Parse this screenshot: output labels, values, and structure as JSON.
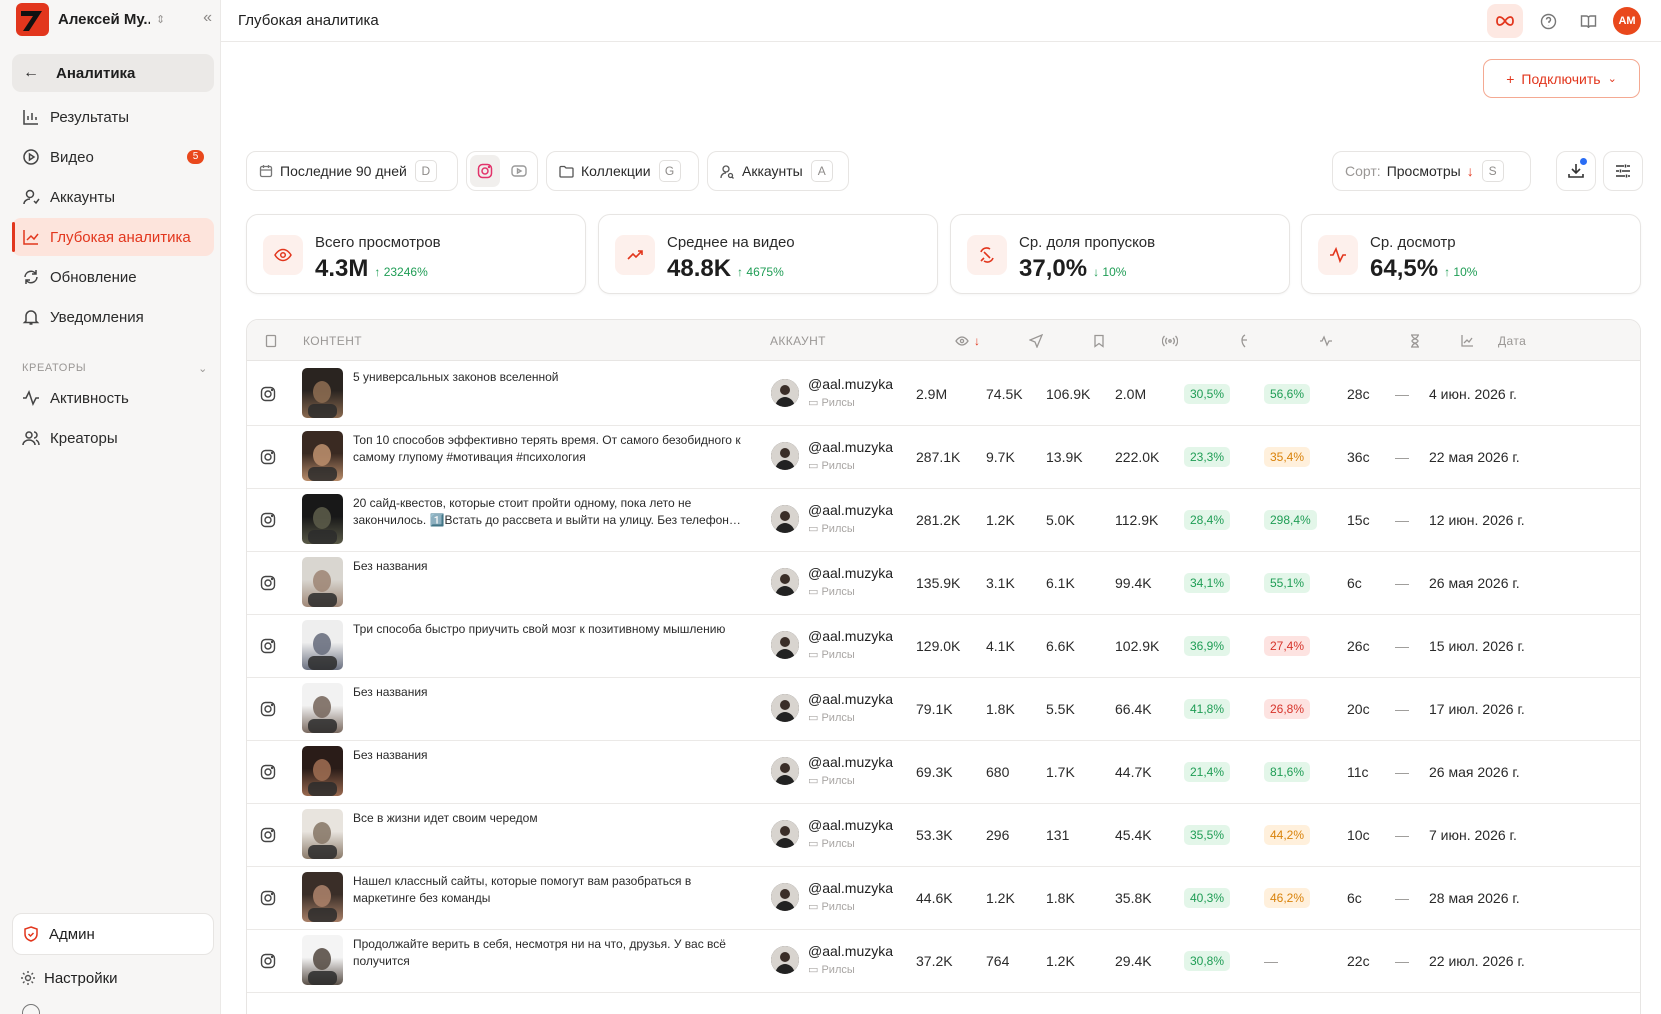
{
  "workspace": {
    "name": "Алексей Му..."
  },
  "sidebar": {
    "back_label": "Аналитика",
    "items": [
      {
        "label": "Результаты",
        "icon": "bar-chart-icon"
      },
      {
        "label": "Видео",
        "icon": "play-circle-icon",
        "badge": "5"
      },
      {
        "label": "Аккаунты",
        "icon": "user-icon"
      },
      {
        "label": "Глубокая аналитика",
        "icon": "line-chart-icon",
        "active": true
      },
      {
        "label": "Обновление",
        "icon": "refresh-icon"
      },
      {
        "label": "Уведомления",
        "icon": "bell-icon"
      }
    ],
    "section_label": "КРЕАТОРЫ",
    "section_items": [
      {
        "label": "Активность",
        "icon": "activity-icon"
      },
      {
        "label": "Креаторы",
        "icon": "users-icon"
      }
    ],
    "admin_label": "Админ",
    "settings_label": "Настройки"
  },
  "header": {
    "title": "Глубокая аналитика",
    "avatar_initials": "AM"
  },
  "connect_label": "Подключить",
  "filters": {
    "period": {
      "label": "Последние 90 дней",
      "key": "D"
    },
    "collections": {
      "label": "Коллекции",
      "key": "G"
    },
    "accounts": {
      "label": "Аккаунты",
      "key": "A"
    },
    "sort": {
      "prefix": "Сорт:",
      "value": "Просмотры",
      "key": "S"
    }
  },
  "stats": [
    {
      "label": "Всего просмотров",
      "value": "4.3M",
      "delta": "23246%",
      "icon": "eye-icon"
    },
    {
      "label": "Среднее на видео",
      "value": "48.8K",
      "delta": "4675%",
      "icon": "trending-up-icon"
    },
    {
      "label": "Ср. доля пропусков",
      "value": "37,0%",
      "delta": "10%",
      "delta_dir": "down",
      "icon": "skip-icon"
    },
    {
      "label": "Ср. досмотр",
      "value": "64,5%",
      "delta": "10%",
      "icon": "pulse-icon"
    }
  ],
  "table": {
    "headers": {
      "content": "КОНТЕНТ",
      "account": "АККАУНТ",
      "date": "Дата"
    },
    "rows": [
      {
        "title": "5 универсальных законов вселенной",
        "account": "@aal.muzyka",
        "type": "Рилсы",
        "views": "2.9M",
        "shares": "74.5K",
        "saves": "106.9K",
        "reach": "2.0M",
        "skip": "30,5%",
        "skip_c": "g",
        "watch": "56,6%",
        "watch_c": "g",
        "dur": "28с",
        "extra": "—",
        "date": "4 июн. 2026 г."
      },
      {
        "title": "Топ 10 способов эффективно терять время. От самого безобидного к самому глупому #мотивация #психология",
        "account": "@aal.muzyka",
        "type": "Рилсы",
        "views": "287.1K",
        "shares": "9.7K",
        "saves": "13.9K",
        "reach": "222.0K",
        "skip": "23,3%",
        "skip_c": "g",
        "watch": "35,4%",
        "watch_c": "o",
        "dur": "36с",
        "extra": "—",
        "date": "22 мая 2026 г."
      },
      {
        "title": "20 сайд-квестов, которые стоит пройти одному, пока лето не закончилось. 1️⃣Встать до рассвета и выйти на улицу. Без телефон…",
        "account": "@aal.muzyka",
        "type": "Рилсы",
        "views": "281.2K",
        "shares": "1.2K",
        "saves": "5.0K",
        "reach": "112.9K",
        "skip": "28,4%",
        "skip_c": "g",
        "watch": "298,4%",
        "watch_c": "g",
        "dur": "15с",
        "extra": "—",
        "date": "12 июн. 2026 г."
      },
      {
        "title": "Без названия",
        "account": "@aal.muzyka",
        "type": "Рилсы",
        "views": "135.9K",
        "shares": "3.1K",
        "saves": "6.1K",
        "reach": "99.4K",
        "skip": "34,1%",
        "skip_c": "g",
        "watch": "55,1%",
        "watch_c": "g",
        "dur": "6с",
        "extra": "—",
        "date": "26 мая 2026 г."
      },
      {
        "title": "Три способа быстро приучить свой мозг к позитивному мышлению",
        "account": "@aal.muzyka",
        "type": "Рилсы",
        "views": "129.0K",
        "shares": "4.1K",
        "saves": "6.6K",
        "reach": "102.9K",
        "skip": "36,9%",
        "skip_c": "g",
        "watch": "27,4%",
        "watch_c": "r",
        "dur": "26с",
        "extra": "—",
        "date": "15 июл. 2026 г."
      },
      {
        "title": "Без названия",
        "account": "@aal.muzyka",
        "type": "Рилсы",
        "views": "79.1K",
        "shares": "1.8K",
        "saves": "5.5K",
        "reach": "66.4K",
        "skip": "41,8%",
        "skip_c": "g",
        "watch": "26,8%",
        "watch_c": "r",
        "dur": "20с",
        "extra": "—",
        "date": "17 июл. 2026 г."
      },
      {
        "title": "Без названия",
        "account": "@aal.muzyka",
        "type": "Рилсы",
        "views": "69.3K",
        "shares": "680",
        "saves": "1.7K",
        "reach": "44.7K",
        "skip": "21,4%",
        "skip_c": "g",
        "watch": "81,6%",
        "watch_c": "g",
        "dur": "11с",
        "extra": "—",
        "date": "26 мая 2026 г."
      },
      {
        "title": "Все в жизни идет своим чередом",
        "account": "@aal.muzyka",
        "type": "Рилсы",
        "views": "53.3K",
        "shares": "296",
        "saves": "131",
        "reach": "45.4K",
        "skip": "35,5%",
        "skip_c": "g",
        "watch": "44,2%",
        "watch_c": "o",
        "dur": "10с",
        "extra": "—",
        "date": "7 июн. 2026 г."
      },
      {
        "title": "Нашел классный сайты, которые помогут вам разобраться в маркетинге без команды",
        "account": "@aal.muzyka",
        "type": "Рилсы",
        "views": "44.6K",
        "shares": "1.2K",
        "saves": "1.8K",
        "reach": "35.8K",
        "skip": "40,3%",
        "skip_c": "g",
        "watch": "46,2%",
        "watch_c": "o",
        "dur": "6с",
        "extra": "—",
        "date": "28 мая 2026 г."
      },
      {
        "title": "Продолжайте верить в себя, несмотря ни на что, друзья. У вас всё получится",
        "account": "@aal.muzyka",
        "type": "Рилсы",
        "views": "37.2K",
        "shares": "764",
        "saves": "1.2K",
        "reach": "29.4K",
        "skip": "30,8%",
        "skip_c": "g",
        "watch": "—",
        "watch_c": "",
        "dur": "22с",
        "extra": "—",
        "date": "22 июл. 2026 г."
      }
    ]
  }
}
